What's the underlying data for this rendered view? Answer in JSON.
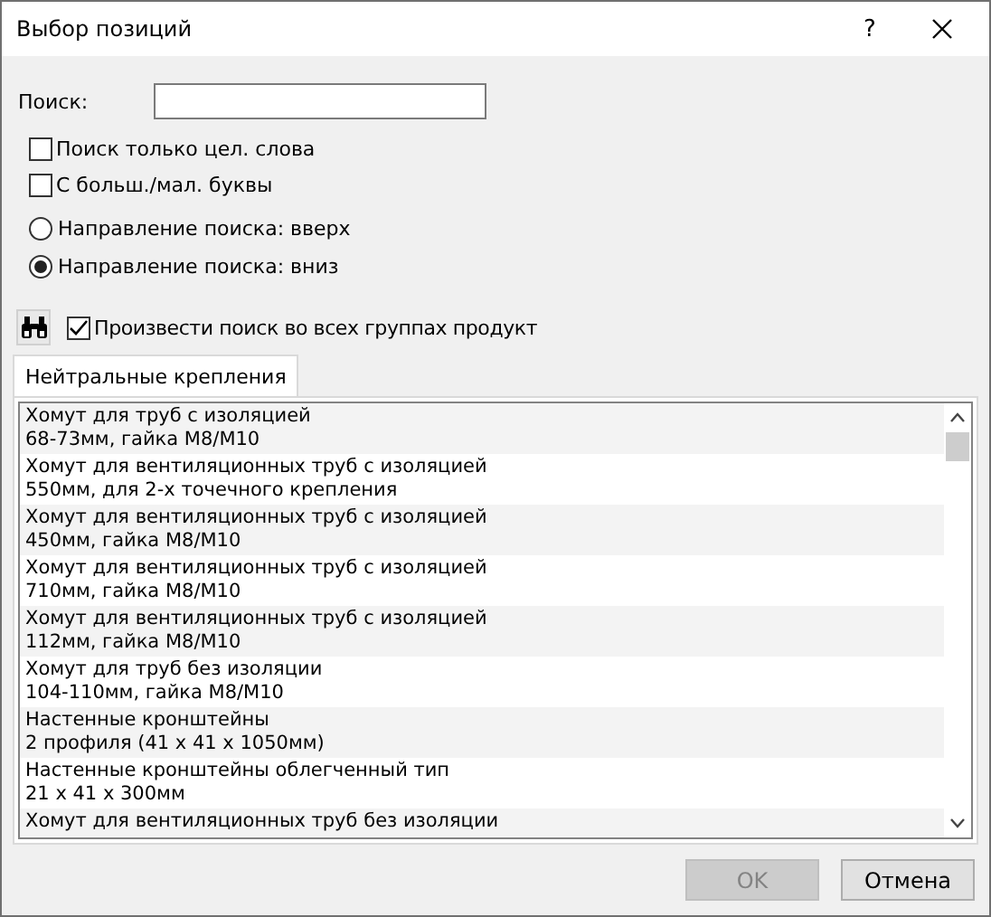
{
  "window": {
    "title": "Выбор позиций",
    "help": "?"
  },
  "search": {
    "label": "Поиск:"
  },
  "options": [
    {
      "kind": "checkbox",
      "label": "Поиск только цел. слова",
      "checked": false
    },
    {
      "kind": "checkbox",
      "label": "С больш./мал. буквы",
      "checked": false
    },
    {
      "kind": "radio",
      "label": "Направление поиска: вверх",
      "selected": false
    },
    {
      "kind": "radio",
      "label": "Направление поиска: вниз",
      "selected": true
    }
  ],
  "all_groups": {
    "label": "Произвести поиск во всех группах продукт",
    "checked": true
  },
  "tabs": [
    {
      "label": "Нейтральные крепления",
      "selected": true
    }
  ],
  "items": [
    {
      "lines": [
        "Хомут для труб с изоляцией",
        "68-73мм, гайка M8/M10"
      ]
    },
    {
      "lines": [
        "Хомут для вентиляционных труб с изоляцией",
        "550мм, для 2-х точечного крепления"
      ]
    },
    {
      "lines": [
        "Хомут для вентиляционных труб с изоляцией",
        "450мм, гайка M8/M10"
      ]
    },
    {
      "lines": [
        "Хомут для вентиляционных труб с изоляцией",
        "710мм, гайка M8/M10"
      ]
    },
    {
      "lines": [
        "Хомут для вентиляционных труб с изоляцией",
        "112мм, гайка M8/M10"
      ]
    },
    {
      "lines": [
        "Хомут для труб без изоляции",
        "104-110мм, гайка M8/M10"
      ]
    },
    {
      "lines": [
        "Настенные кронштейны",
        "2 профиля (41 x 41 x 1050мм)"
      ]
    },
    {
      "lines": [
        "Настенные кронштейны облегченный тип",
        "21 x 41 x 300мм"
      ]
    },
    {
      "lines": [
        "Хомут для вентиляционных труб без изоляции"
      ]
    }
  ],
  "buttons": [
    {
      "label": "OK",
      "disabled": true
    },
    {
      "label": "Отмена",
      "disabled": false
    }
  ]
}
